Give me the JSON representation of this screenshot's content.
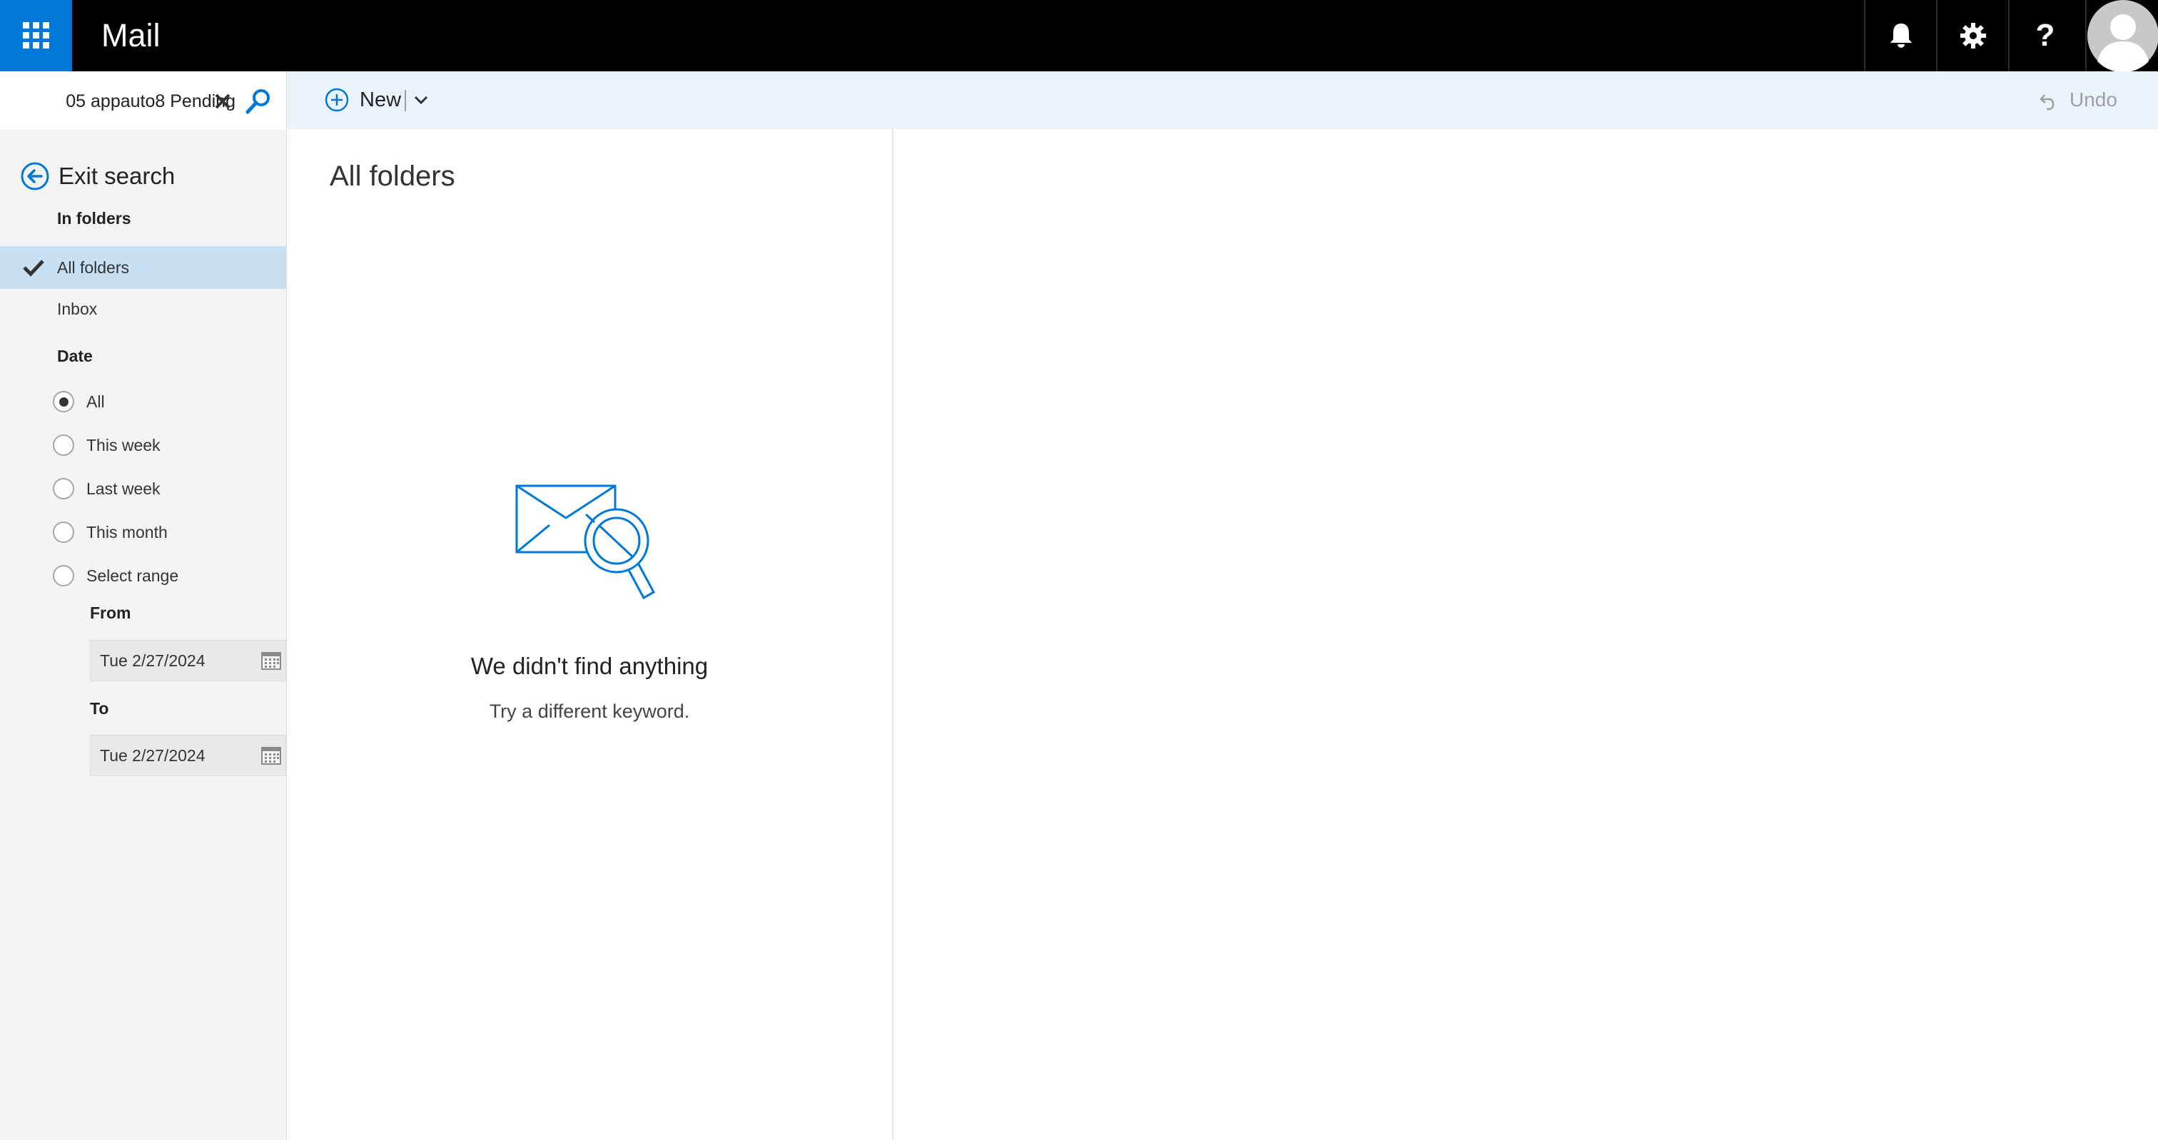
{
  "header": {
    "app_title": "Mail",
    "waffle_icon": "app-launcher-icon",
    "notifications_icon": "bell-icon",
    "settings_icon": "gear-icon",
    "help_icon": "question-icon",
    "avatar_icon": "person-avatar-icon"
  },
  "search": {
    "value": "05 appauto8 Pending"
  },
  "sidebar": {
    "exit_label": "Exit search",
    "in_folders_label": "In folders",
    "folders": [
      {
        "label": "All folders",
        "selected": true
      },
      {
        "label": "Inbox",
        "selected": false
      }
    ],
    "date_label": "Date",
    "date_options": [
      {
        "label": "All",
        "checked": true
      },
      {
        "label": "This week",
        "checked": false
      },
      {
        "label": "Last week",
        "checked": false
      },
      {
        "label": "This month",
        "checked": false
      },
      {
        "label": "Select range",
        "checked": false
      }
    ],
    "from_label": "From",
    "from_value": "Tue 2/27/2024",
    "to_label": "To",
    "to_value": "Tue 2/27/2024"
  },
  "toolbar": {
    "new_label": "New",
    "undo_label": "Undo"
  },
  "list": {
    "title": "All folders",
    "empty_title": "We didn't find anything",
    "empty_subtitle": "Try a different keyword."
  },
  "colors": {
    "accent": "#0078d7",
    "topbar": "#000000",
    "selection": "#c7e0f4",
    "commandbar": "#eaf3fb"
  }
}
